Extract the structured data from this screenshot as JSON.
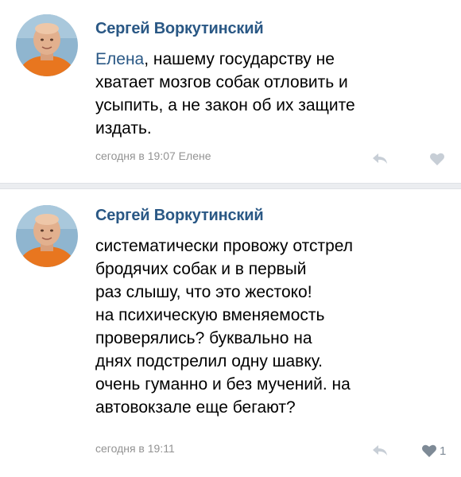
{
  "comments": [
    {
      "author": "Сергей Воркутинский",
      "mention": "Елена",
      "text_first_rest": ", нашему государству не",
      "lines": [
        "хватает мозгов собак отловить и",
        "усыпить, а не закон об их защите",
        "издать."
      ],
      "meta": "сегодня в 19:07 Елене",
      "reply_icon": "reply-arrow-icon",
      "like_icon": "heart-icon",
      "like_count": ""
    },
    {
      "author": "Сергей Воркутинский",
      "lines": [
        "систематически провожу отстрел",
        "бродячих собак и в первый",
        "раз слышу, что это жестоко!",
        "на психическую вменяемость",
        "проверялись? буквально на",
        "днях подстрелил одну шавку.",
        "очень гуманно и без мучений. на",
        "автовокзале еще бегают?"
      ],
      "meta": "сегодня в 19:11",
      "reply_icon": "reply-arrow-icon",
      "like_icon": "heart-icon",
      "like_count": "1"
    }
  ],
  "colors": {
    "link": "#2a5885",
    "meta": "#939393",
    "icon": "#c7ced6",
    "liked_icon": "#7e8a96",
    "divider": "#ebedf0"
  }
}
